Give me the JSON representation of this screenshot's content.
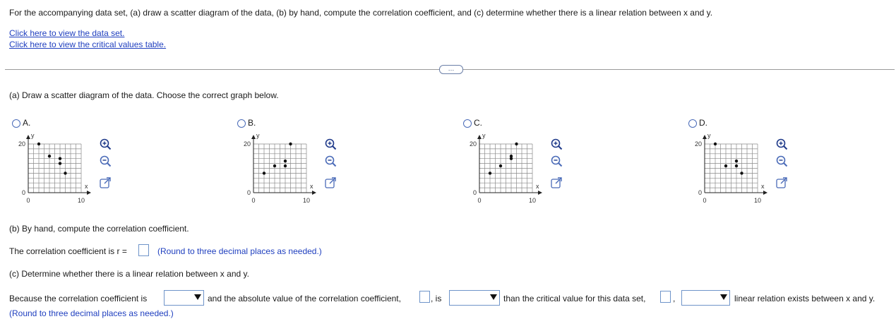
{
  "question": {
    "text": "For the accompanying data set, (a) draw a scatter diagram of the data, (b) by hand, compute the correlation coefficient, and (c) determine whether there is a linear relation between x and y.",
    "link_dataset": "Click here to view the data set.",
    "link_critical": "Click here to view the critical values table."
  },
  "divider_button": "…",
  "part_a": {
    "label": "(a) Draw a scatter diagram of the data. Choose the correct graph below.",
    "options": [
      {
        "letter": "A.",
        "points": [
          [
            2,
            20
          ],
          [
            4,
            15
          ],
          [
            6,
            14
          ],
          [
            6,
            12
          ],
          [
            7,
            8
          ]
        ]
      },
      {
        "letter": "B.",
        "points": [
          [
            2,
            8
          ],
          [
            4,
            11
          ],
          [
            6,
            11
          ],
          [
            6,
            13
          ],
          [
            7,
            20
          ]
        ]
      },
      {
        "letter": "C.",
        "points": [
          [
            2,
            8
          ],
          [
            4,
            11
          ],
          [
            6,
            14
          ],
          [
            6,
            15
          ],
          [
            7,
            20
          ]
        ]
      },
      {
        "letter": "D.",
        "points": [
          [
            2,
            20
          ],
          [
            4,
            11
          ],
          [
            6,
            11
          ],
          [
            6,
            13
          ],
          [
            7,
            8
          ]
        ]
      }
    ],
    "axis": {
      "y_tick": "20",
      "y_zero": "0",
      "x_zero": "0",
      "x_tick": "10",
      "x_label": "x",
      "y_label": "y",
      "xlim": [
        0,
        10
      ],
      "ylim": [
        0,
        20
      ]
    }
  },
  "part_b": {
    "label": "(b) By hand, compute the correlation coefficient.",
    "prefix": "The correlation coefficient is r =",
    "hint": "(Round to three decimal places as needed.)"
  },
  "part_c": {
    "label": "(c) Determine whether there is a linear relation between x and y.",
    "text1": "Because the correlation coefficient is",
    "text2": "and the absolute value of the correlation coefficient,",
    "text3": ", is",
    "text4": "than the critical value for this data set,",
    "text5": ",",
    "text6": "linear relation exists between x and y.",
    "hint": "(Round to three decimal places as needed.)"
  }
}
